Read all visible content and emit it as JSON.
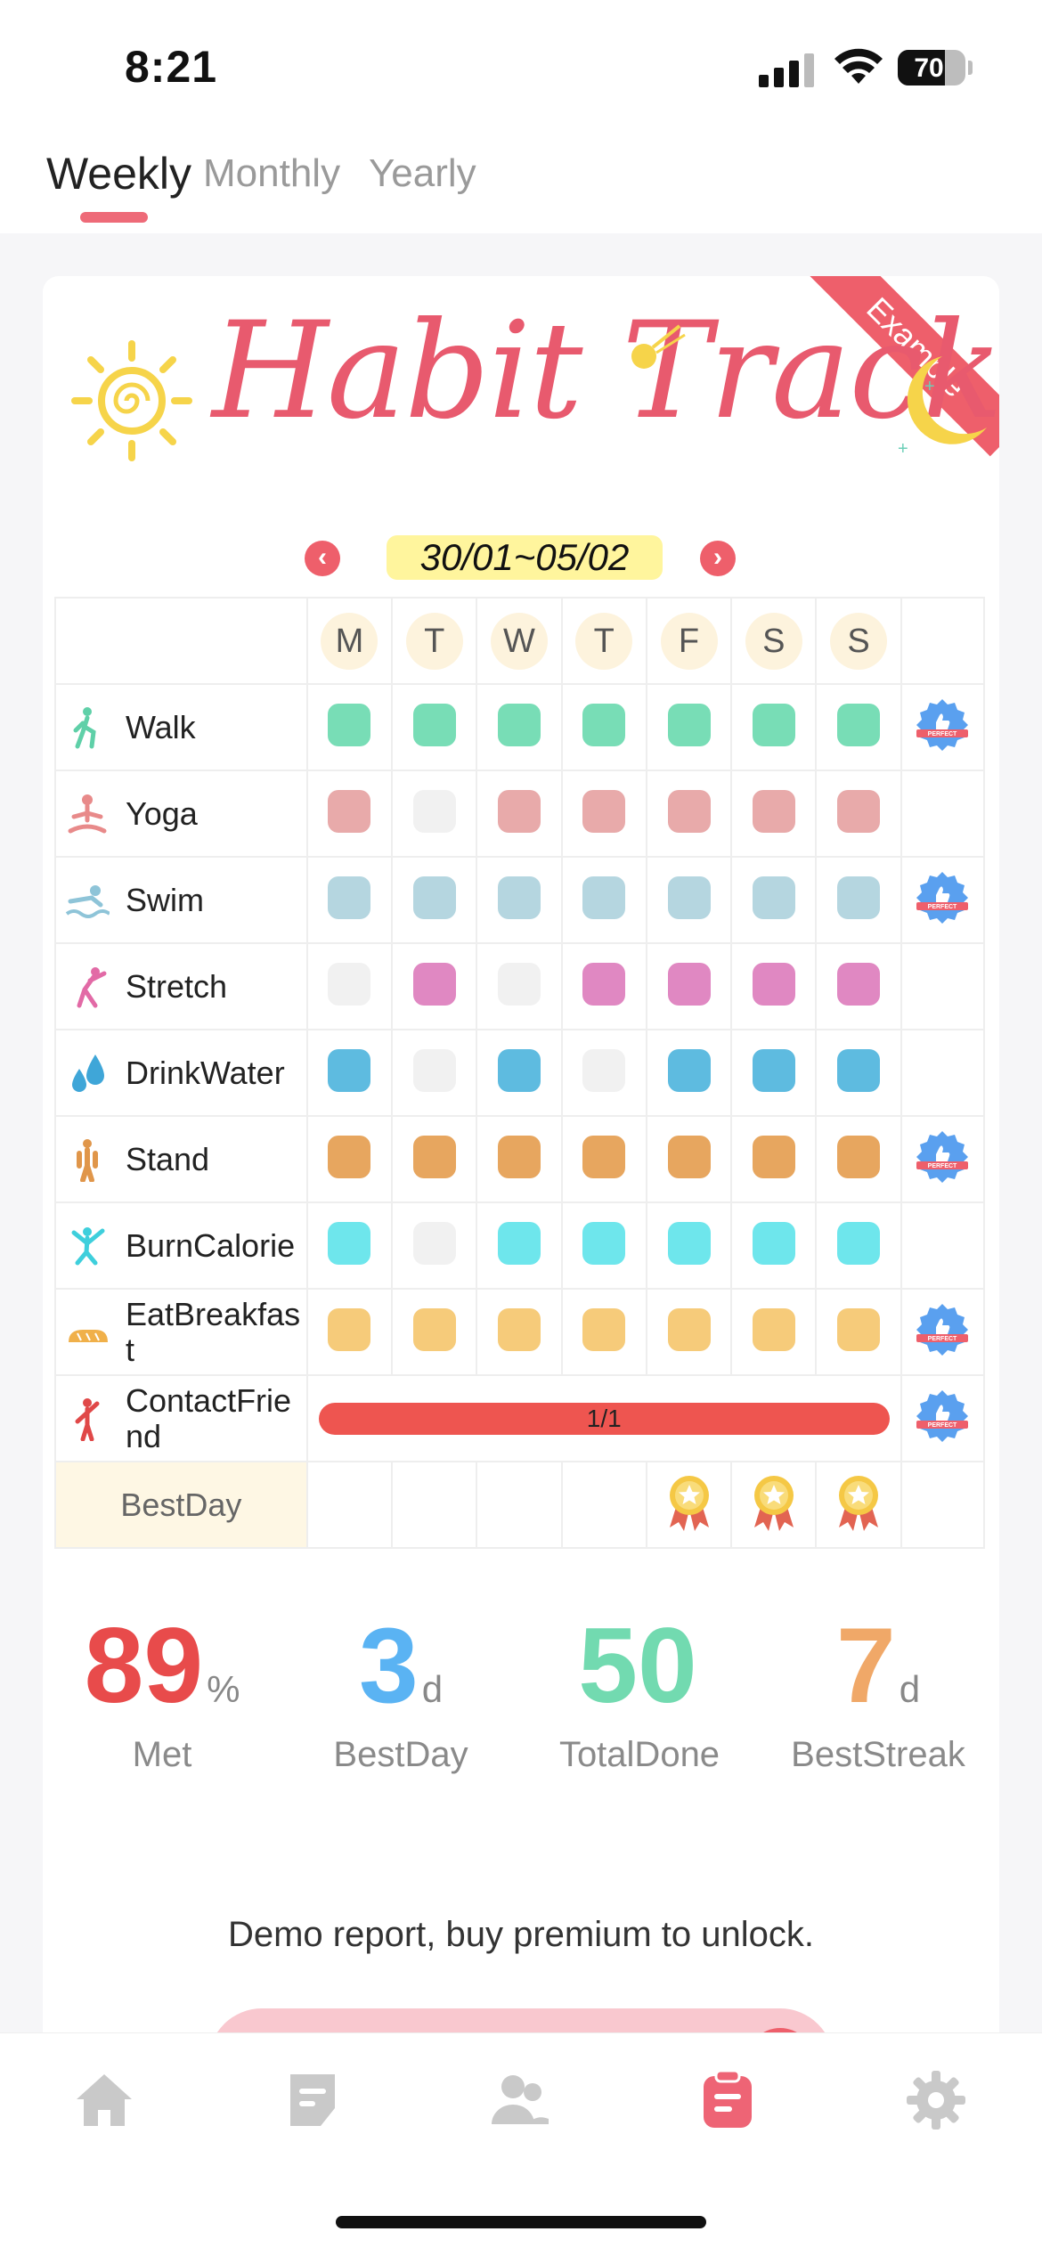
{
  "status": {
    "time": "8:21",
    "battery": "70",
    "battery_level": 0.7
  },
  "tabs": [
    {
      "label": "Weekly",
      "active": true
    },
    {
      "label": "Monthly",
      "active": false
    },
    {
      "label": "Yearly",
      "active": false
    }
  ],
  "card": {
    "ribbon": "Example",
    "title": "Habit Tracker",
    "date_range": "30/01~05/02",
    "days": [
      "M",
      "T",
      "W",
      "T",
      "F",
      "S",
      "S"
    ],
    "habits": [
      {
        "name": "Walk",
        "icon": "walk-icon",
        "color": "#78ddb6",
        "done": [
          1,
          1,
          1,
          1,
          1,
          1,
          1
        ],
        "perfect": true
      },
      {
        "name": "Yoga",
        "icon": "yoga-icon",
        "color": "#e8aaaa",
        "done": [
          1,
          0,
          1,
          1,
          1,
          1,
          1
        ],
        "perfect": false
      },
      {
        "name": "Swim",
        "icon": "swim-icon",
        "color": "#b5d6e0",
        "done": [
          1,
          1,
          1,
          1,
          1,
          1,
          1
        ],
        "perfect": true
      },
      {
        "name": "Stretch",
        "icon": "stretch-icon",
        "color": "#e088c2",
        "done": [
          0,
          1,
          0,
          1,
          1,
          1,
          1
        ],
        "perfect": false
      },
      {
        "name": "DrinkWater",
        "icon": "drink-water-icon",
        "color": "#5ebbe0",
        "done": [
          1,
          0,
          1,
          0,
          1,
          1,
          1
        ],
        "perfect": false
      },
      {
        "name": "Stand",
        "icon": "stand-icon",
        "color": "#e7a65f",
        "done": [
          1,
          1,
          1,
          1,
          1,
          1,
          1
        ],
        "perfect": true
      },
      {
        "name": "BurnCalorie",
        "icon": "burn-calorie-icon",
        "color": "#6ee6ec",
        "done": [
          1,
          0,
          1,
          1,
          1,
          1,
          1
        ],
        "perfect": false
      },
      {
        "name": "EatBreakfast",
        "icon": "breakfast-icon",
        "color": "#f6cb7a",
        "done": [
          1,
          1,
          1,
          1,
          1,
          1,
          1
        ],
        "perfect": true
      }
    ],
    "contact_habit": {
      "name": "ContactFriend",
      "icon": "contact-friend-icon",
      "progress": "1/1",
      "perfect": true
    },
    "perfect_badge": "PERFECT",
    "bestday": {
      "label": "BestDay",
      "medals": [
        0,
        0,
        0,
        0,
        1,
        1,
        1
      ]
    },
    "stats": [
      {
        "value": "89",
        "unit": "%",
        "label": "Met",
        "color": "#e84b4b"
      },
      {
        "value": "3",
        "unit": "d",
        "label": "BestDay",
        "color": "#5ab3f3"
      },
      {
        "value": "50",
        "unit": "",
        "label": "TotalDone",
        "color": "#72dab0"
      },
      {
        "value": "7",
        "unit": "d",
        "label": "BestStreak",
        "color": "#f0a868"
      }
    ],
    "demo_text": "Demo report, buy premium to unlock."
  },
  "bottom_nav": [
    {
      "icon": "home-icon",
      "active": false
    },
    {
      "icon": "notes-icon",
      "active": false
    },
    {
      "icon": "friends-icon",
      "active": false
    },
    {
      "icon": "report-icon",
      "active": true
    },
    {
      "icon": "settings-icon",
      "active": false
    }
  ]
}
